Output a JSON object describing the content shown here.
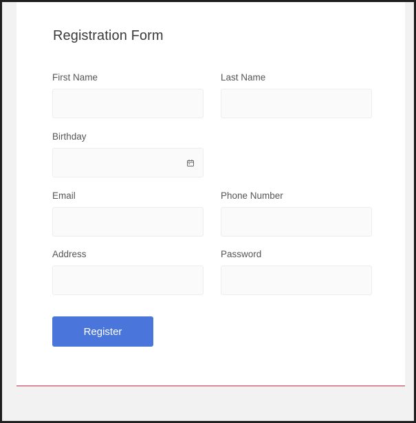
{
  "form": {
    "title": "Registration Form",
    "fields": {
      "first_name": {
        "label": "First Name",
        "value": "",
        "placeholder": ""
      },
      "last_name": {
        "label": "Last Name",
        "value": "",
        "placeholder": ""
      },
      "birthday": {
        "label": "Birthday",
        "value": "",
        "placeholder": ""
      },
      "email": {
        "label": "Email",
        "value": "",
        "placeholder": ""
      },
      "phone": {
        "label": "Phone Number",
        "value": "",
        "placeholder": ""
      },
      "address": {
        "label": "Address",
        "value": "",
        "placeholder": ""
      },
      "password": {
        "label": "Password",
        "value": "",
        "placeholder": ""
      }
    },
    "submit_label": "Register",
    "colors": {
      "accent": "#4a76dc",
      "card_bottom_border": "#d98a9a",
      "page_background": "#f2f2f2"
    },
    "icons": {
      "birthday_picker": "calendar-icon"
    }
  }
}
